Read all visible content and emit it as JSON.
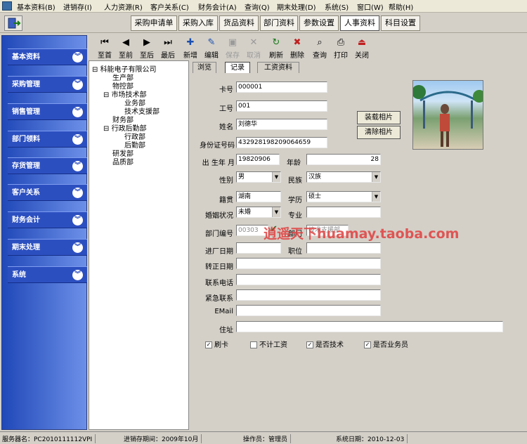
{
  "menubar": {
    "items": [
      "基本资料(B)",
      "进销存(I)",
      "人力资源(R)",
      "客户关系(C)",
      "财务会计(A)",
      "查询(Q)",
      "期末处理(D)",
      "系统(S)",
      "窗口(W)",
      "帮助(H)"
    ]
  },
  "toolbar1": {
    "tabs": [
      "采购申请单",
      "采购入库",
      "货品资料",
      "部门资料",
      "参数设置",
      "人事资料",
      "科目设置"
    ],
    "active": "人事资料"
  },
  "sidebar": {
    "items": [
      "基本资料",
      "采购管理",
      "销售管理",
      "部门领料",
      "存货管理",
      "客户关系",
      "财务会计",
      "期末处理",
      "系统"
    ]
  },
  "toolbar2": {
    "tools": [
      {
        "label": "至首",
        "icon": "first-icon",
        "glyph": "⏮"
      },
      {
        "label": "至前",
        "icon": "prev-icon",
        "glyph": "◀"
      },
      {
        "label": "至后",
        "icon": "next-icon",
        "glyph": "▶"
      },
      {
        "label": "最后",
        "icon": "last-icon",
        "glyph": "⏭"
      },
      {
        "label": "新增",
        "icon": "add-icon",
        "glyph": "✚"
      },
      {
        "label": "编辑",
        "icon": "edit-icon",
        "glyph": "✎"
      },
      {
        "label": "保存",
        "icon": "save-icon",
        "glyph": "▣"
      },
      {
        "label": "取消",
        "icon": "cancel-icon",
        "glyph": "✕"
      },
      {
        "label": "刷新",
        "icon": "refresh-icon",
        "glyph": "↻"
      },
      {
        "label": "删除",
        "icon": "delete-icon",
        "glyph": "✖"
      },
      {
        "label": "查询",
        "icon": "search-icon",
        "glyph": "⌕"
      },
      {
        "label": "打印",
        "icon": "print-icon",
        "glyph": "⎙"
      },
      {
        "label": "关闭",
        "icon": "close-icon",
        "glyph": "⏏"
      }
    ]
  },
  "tree": {
    "nodes": [
      "科能电子有限公司",
      "生产部",
      "物控部",
      "市场技术部",
      "业务部",
      "技术支援部",
      "财务部",
      "行政后勤部",
      "行政部",
      "后勤部",
      "研发部",
      "品质部"
    ]
  },
  "form": {
    "tabs": [
      "浏览",
      "记录",
      "工资资料"
    ],
    "active_tab": "记录",
    "labels": {
      "card": "卡号",
      "emp_no": "工号",
      "name": "姓名",
      "id_no": "身份证号码",
      "birth": "出 生年 月",
      "age": "年龄",
      "gender": "性别",
      "ethnicity": "民族",
      "hometown": "籍贯",
      "education": "学历",
      "marital": "婚姻状况",
      "major": "专业",
      "dept_no": "部门编号",
      "dept": "部门",
      "hire_date": "进厂日期",
      "position": "职位",
      "regular_date": "转正日期",
      "phone": "联系电话",
      "emergency": "紧急联系",
      "email": "EMail",
      "address": "住址"
    },
    "values": {
      "card": "000001",
      "emp_no": "001",
      "name": "刘德华",
      "id_no": "432928198209064659",
      "birth": "19820906",
      "age": "28",
      "gender": "男",
      "ethnicity": "汉族",
      "hometown": "湖南",
      "education": "硕士",
      "marital": "未婚",
      "major": "",
      "dept_no": "00303",
      "dept": "技术支援部",
      "hire_date": "",
      "position": "",
      "regular_date": "",
      "phone": "",
      "emergency": "",
      "email": "",
      "address": ""
    },
    "buttons": {
      "load_photo": "装载相片",
      "clear_photo": "清除相片"
    },
    "checks": [
      {
        "label": "刷卡",
        "checked": true
      },
      {
        "label": "不计工资",
        "checked": false
      },
      {
        "label": "是否技术",
        "checked": true
      },
      {
        "label": "是否业务员",
        "checked": true
      }
    ]
  },
  "watermark": "逍遥天下huamay.taoba.com",
  "status": {
    "server": "服务器名：PC2010111112VPI",
    "period": "进销存期间：2009年10月",
    "operator": "操作员：管理员",
    "sys_date": "系统日期：2010-12-03"
  }
}
